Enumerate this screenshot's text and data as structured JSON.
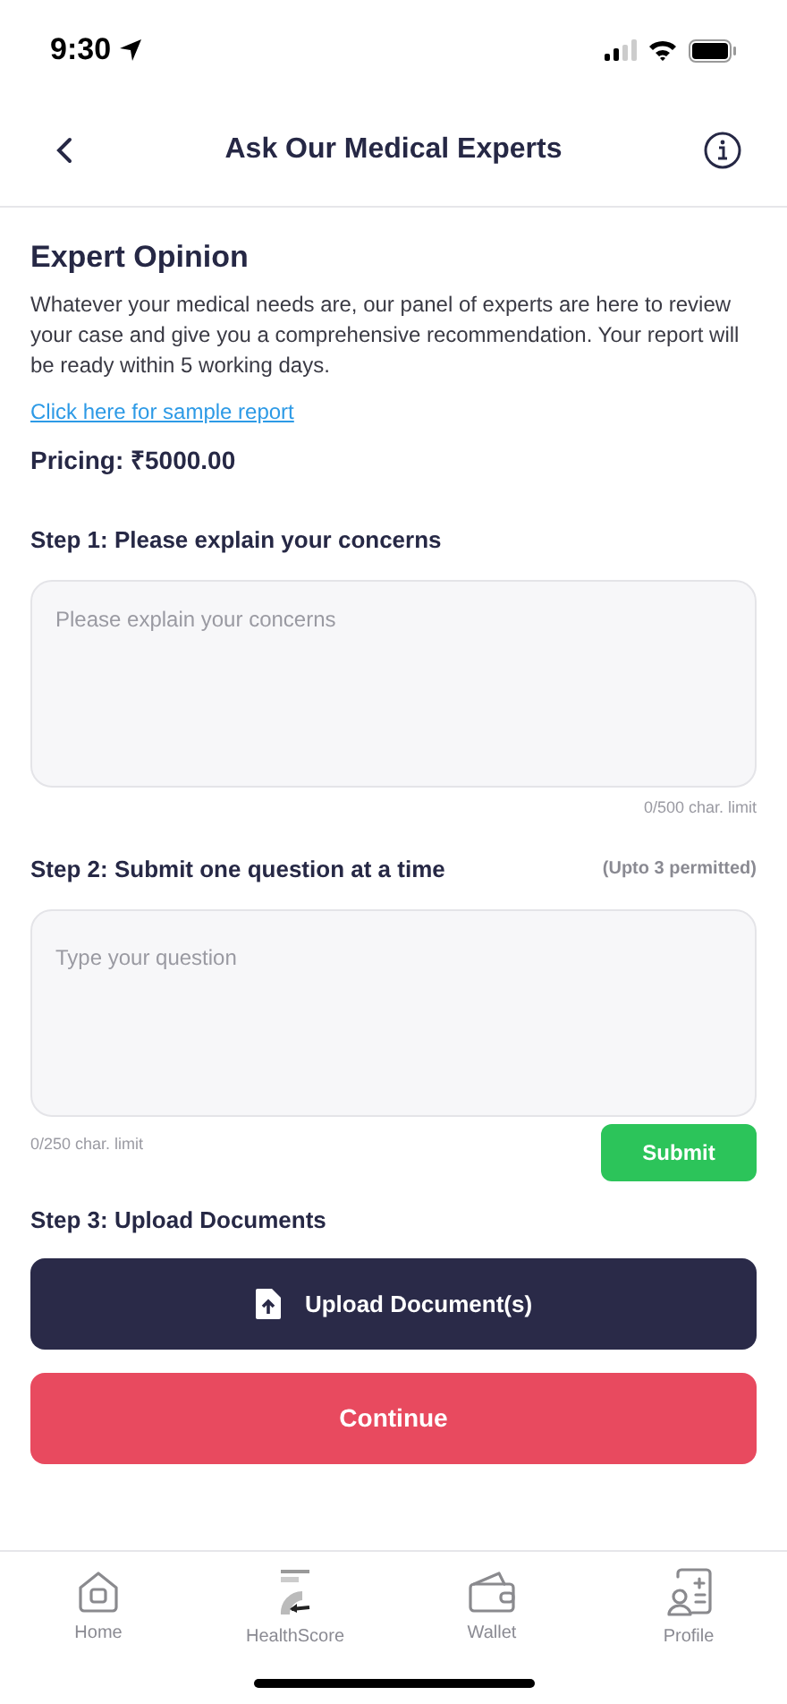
{
  "status_bar": {
    "time": "9:30"
  },
  "header": {
    "title": "Ask Our Medical Experts"
  },
  "intro": {
    "title": "Expert Opinion",
    "description": "Whatever your medical needs are, our panel of experts are here to review your case and give you a comprehensive recommendation. Your report will be ready within 5 working days.",
    "link": "Click here for sample report",
    "pricing": "Pricing: ₹5000.00"
  },
  "step1": {
    "label": "Step 1: Please explain your concerns",
    "placeholder": "Please explain your concerns",
    "counter": "0/500 char. limit"
  },
  "step2": {
    "label": "Step 2: Submit one question at a time",
    "note": "(Upto 3 permitted)",
    "placeholder": "Type your question",
    "counter": "0/250 char. limit",
    "button": "Submit"
  },
  "step3": {
    "label": "Step 3: Upload Documents",
    "button": "Upload Document(s)"
  },
  "continue_button": "Continue",
  "bottom_nav": [
    {
      "kind": "home",
      "label": "Home"
    },
    {
      "kind": "score",
      "label": "HealthScore"
    },
    {
      "kind": "wallet",
      "label": "Wallet"
    },
    {
      "kind": "profile",
      "label": "Profile"
    }
  ]
}
